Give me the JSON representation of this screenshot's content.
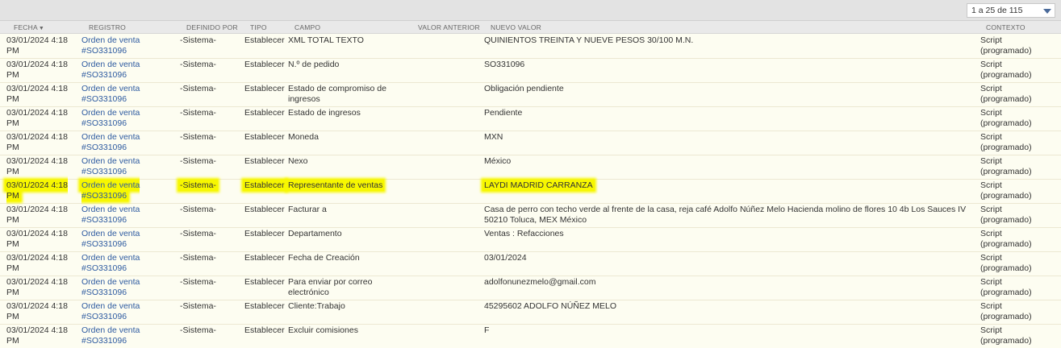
{
  "pager": {
    "label": "1 a 25 de 115"
  },
  "columns": {
    "fecha": "FECHA",
    "registro": "REGISTRO",
    "definido_por": "DEFINIDO POR",
    "tipo": "TIPO",
    "campo": "CAMPO",
    "valor_anterior": "VALOR ANTERIOR",
    "nuevo_valor": "NUEVO VALOR",
    "contexto": "CONTEXTO"
  },
  "highlight_color": "#f7f700",
  "rows": [
    {
      "fecha": "03/01/2024 4:18 PM",
      "registro": "Orden de venta #SO331096",
      "definido_por": "-Sistema-",
      "tipo": "Establecer",
      "campo": "XML TOTAL TEXTO",
      "valor_anterior": "",
      "nuevo_valor": "QUINIENTOS TREINTA Y NUEVE PESOS 30/100 M.N.",
      "contexto": "Script (programado)"
    },
    {
      "fecha": "03/01/2024 4:18 PM",
      "registro": "Orden de venta #SO331096",
      "definido_por": "-Sistema-",
      "tipo": "Establecer",
      "campo": "N.º de pedido",
      "valor_anterior": "",
      "nuevo_valor": "SO331096",
      "contexto": "Script (programado)"
    },
    {
      "fecha": "03/01/2024 4:18 PM",
      "registro": "Orden de venta #SO331096",
      "definido_por": "-Sistema-",
      "tipo": "Establecer",
      "campo": "Estado de compromiso de ingresos",
      "valor_anterior": "",
      "nuevo_valor": "Obligación pendiente",
      "contexto": "Script (programado)"
    },
    {
      "fecha": "03/01/2024 4:18 PM",
      "registro": "Orden de venta #SO331096",
      "definido_por": "-Sistema-",
      "tipo": "Establecer",
      "campo": "Estado de ingresos",
      "valor_anterior": "",
      "nuevo_valor": "Pendiente",
      "contexto": "Script (programado)"
    },
    {
      "fecha": "03/01/2024 4:18 PM",
      "registro": "Orden de venta #SO331096",
      "definido_por": "-Sistema-",
      "tipo": "Establecer",
      "campo": "Moneda",
      "valor_anterior": "",
      "nuevo_valor": "MXN",
      "contexto": "Script (programado)"
    },
    {
      "fecha": "03/01/2024 4:18 PM",
      "registro": "Orden de venta #SO331096",
      "definido_por": "-Sistema-",
      "tipo": "Establecer",
      "campo": "Nexo",
      "valor_anterior": "",
      "nuevo_valor": "México",
      "contexto": "Script (programado)"
    },
    {
      "fecha": "03/01/2024 4:18 PM",
      "registro": "Orden de venta #SO331096",
      "definido_por": "-Sistema-",
      "tipo": "Establecer",
      "campo": "Representante de ventas",
      "valor_anterior": "",
      "nuevo_valor": "LAYDI MADRID CARRANZA",
      "contexto": "Script (programado)",
      "highlighted": true
    },
    {
      "fecha": "03/01/2024 4:18 PM",
      "registro": "Orden de venta #SO331096",
      "definido_por": "-Sistema-",
      "tipo": "Establecer",
      "campo": "Facturar a",
      "valor_anterior": "",
      "nuevo_valor": "Casa de perro con techo verde al frente de la casa, reja café Adolfo Núñez Melo Hacienda molino de flores 10 4b Los Sauces IV 50210 Toluca, MEX México",
      "contexto": "Script (programado)"
    },
    {
      "fecha": "03/01/2024 4:18 PM",
      "registro": "Orden de venta #SO331096",
      "definido_por": "-Sistema-",
      "tipo": "Establecer",
      "campo": "Departamento",
      "valor_anterior": "",
      "nuevo_valor": "Ventas : Refacciones",
      "contexto": "Script (programado)"
    },
    {
      "fecha": "03/01/2024 4:18 PM",
      "registro": "Orden de venta #SO331096",
      "definido_por": "-Sistema-",
      "tipo": "Establecer",
      "campo": "Fecha de Creación",
      "valor_anterior": "",
      "nuevo_valor": "03/01/2024",
      "contexto": "Script (programado)"
    },
    {
      "fecha": "03/01/2024 4:18 PM",
      "registro": "Orden de venta #SO331096",
      "definido_por": "-Sistema-",
      "tipo": "Establecer",
      "campo": "Para enviar por correo electrónico",
      "valor_anterior": "",
      "nuevo_valor": "adolfonunezmelo@gmail.com",
      "contexto": "Script (programado)"
    },
    {
      "fecha": "03/01/2024 4:18 PM",
      "registro": "Orden de venta #SO331096",
      "definido_por": "-Sistema-",
      "tipo": "Establecer",
      "campo": "Cliente:Trabajo",
      "valor_anterior": "",
      "nuevo_valor": "45295602 ADOLFO NÚÑEZ MELO",
      "contexto": "Script (programado)"
    },
    {
      "fecha": "03/01/2024 4:18 PM",
      "registro": "Orden de venta #SO331096",
      "definido_por": "-Sistema-",
      "tipo": "Establecer",
      "campo": "Excluir comisiones",
      "valor_anterior": "",
      "nuevo_valor": "F",
      "contexto": "Script (programado)"
    }
  ]
}
